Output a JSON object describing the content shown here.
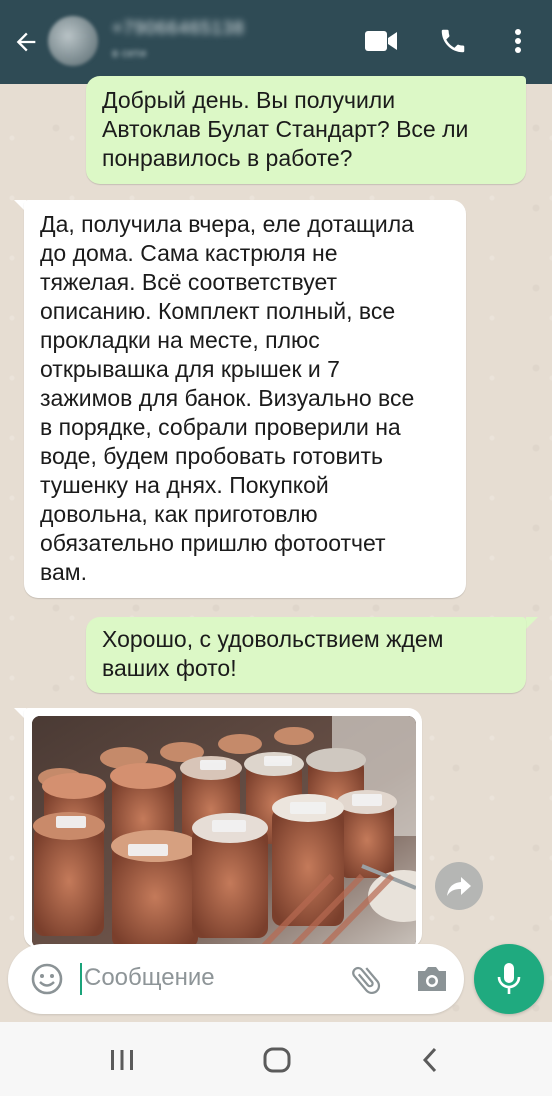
{
  "header": {
    "contact_name": "+79066465138",
    "contact_status": "в сети",
    "icons": [
      "back-arrow-icon",
      "video-call-icon",
      "voice-call-icon",
      "more-options-icon"
    ]
  },
  "messages": [
    {
      "direction": "outgoing",
      "text": "Добрый день. Вы получили\nАвтоклав Булат Стандарт? Все ли\nпонравилось в работе?"
    },
    {
      "direction": "incoming",
      "text": "Да, получила вчера, еле дотащила\nдо дома. Сама кастрюля не\nтяжелая. Всё соответствует\nописанию. Комплект полный, все\nпрокладки на месте, плюс\nоткрывашка для крышек и 7\nзажимов для банок. Визуально все\nв порядке, собрали проверили на\nводе, будем пробовать готовить\nтушенку на днях. Покупкой\nдовольна, как приготовлю\nобязательно пришлю фотоотчет\nвам."
    },
    {
      "direction": "outgoing",
      "text": "Хорошо, с удовольствием ждем\nваших фото!"
    },
    {
      "direction": "incoming",
      "type": "image",
      "description": "photo of canned food jars"
    }
  ],
  "input": {
    "placeholder": "Сообщение",
    "icons": [
      "emoji-icon",
      "attach-icon",
      "camera-icon",
      "mic-icon"
    ]
  },
  "navbar": {
    "icons": [
      "recent-apps-icon",
      "home-icon",
      "back-icon"
    ]
  },
  "colors": {
    "header_bg": "#2f4b55",
    "outgoing_bubble": "#dcf8c6",
    "incoming_bubble": "#ffffff",
    "accent_green": "#1faa7f"
  }
}
